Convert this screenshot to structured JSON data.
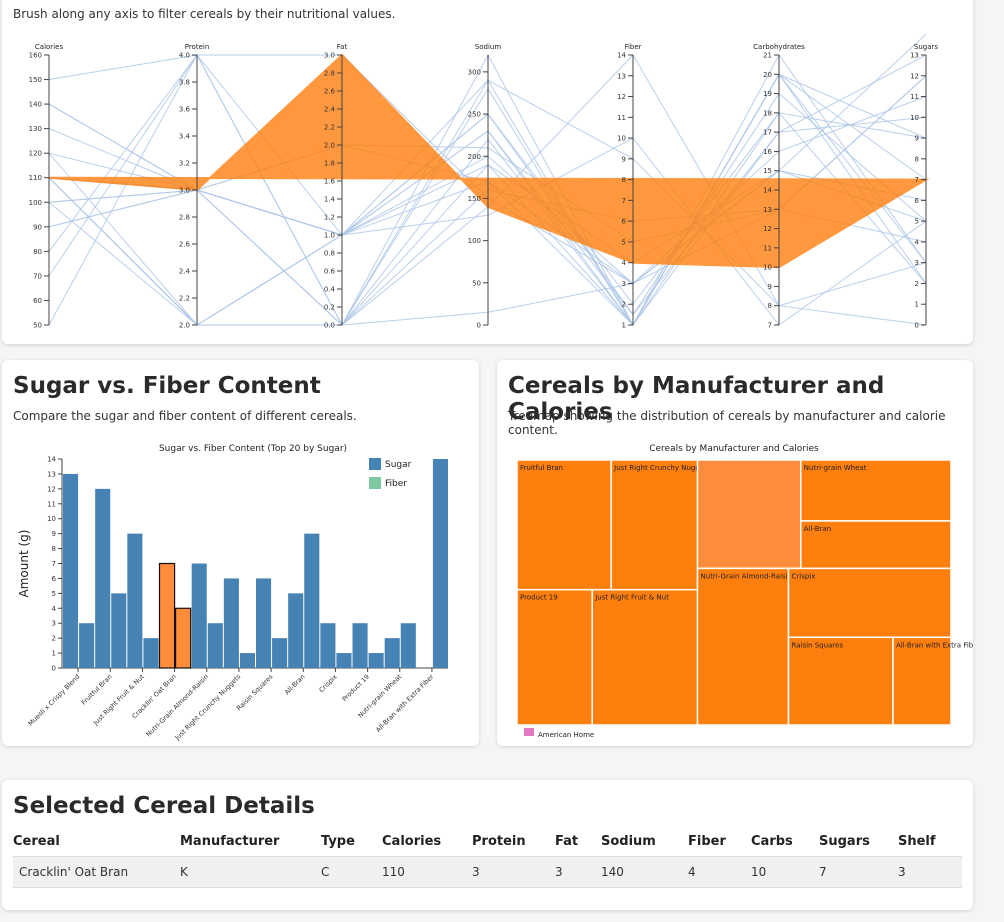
{
  "parallel": {
    "instruction": "Brush along any axis to filter cereals by their nutritional values.",
    "axes": [
      {
        "label": "Calories",
        "min": 50,
        "max": 160,
        "ticks": [
          50,
          60,
          70,
          80,
          90,
          100,
          110,
          120,
          130,
          140,
          150,
          160
        ],
        "dec": 0
      },
      {
        "label": "Protein",
        "min": 2.0,
        "max": 4.0,
        "ticks": [
          2.0,
          2.2,
          2.4,
          2.6,
          2.8,
          3.0,
          3.2,
          3.4,
          3.6,
          3.8,
          4.0
        ],
        "dec": 1
      },
      {
        "label": "Fat",
        "min": 0.0,
        "max": 3.0,
        "ticks": [
          0.0,
          0.2,
          0.4,
          0.6,
          0.8,
          1.0,
          1.2,
          1.4,
          1.6,
          1.8,
          2.0,
          2.2,
          2.4,
          2.6,
          2.8,
          3.0
        ],
        "dec": 1
      },
      {
        "label": "Sodium",
        "min": 0,
        "max": 320,
        "ticks": [
          0,
          50,
          100,
          150,
          200,
          250,
          300
        ],
        "dec": 0
      },
      {
        "label": "Fiber",
        "min": 1,
        "max": 14,
        "ticks": [
          1,
          2,
          3,
          4,
          5,
          6,
          7,
          8,
          9,
          10,
          11,
          12,
          13,
          14
        ],
        "dec": 0
      },
      {
        "label": "Carbohydrates",
        "min": 7,
        "max": 21,
        "ticks": [
          7,
          8,
          9,
          10,
          11,
          12,
          13,
          14,
          15,
          16,
          17,
          18,
          19,
          20,
          21
        ],
        "dec": 0
      },
      {
        "label": "Sugars",
        "min": 0,
        "max": 13,
        "ticks": [
          0,
          1,
          2,
          3,
          4,
          5,
          6,
          7,
          8,
          9,
          10,
          11,
          12,
          13
        ],
        "dec": 0
      }
    ],
    "lines": [
      [
        110,
        2,
        0,
        220,
        1,
        20,
        7
      ],
      [
        110,
        2,
        1,
        290,
        1,
        21,
        3
      ],
      [
        140,
        3,
        1,
        170,
        3,
        13,
        12
      ],
      [
        120,
        3,
        2,
        170,
        1,
        18,
        9
      ],
      [
        100,
        2,
        0,
        190,
        1,
        20,
        9
      ],
      [
        90,
        3,
        0,
        15,
        3,
        15,
        5
      ],
      [
        120,
        2,
        1,
        230,
        1,
        17,
        10
      ],
      [
        110,
        3,
        1,
        250,
        1.5,
        19,
        5
      ],
      [
        100,
        3,
        1,
        200,
        3,
        15,
        6
      ],
      [
        70,
        4,
        1,
        130,
        10,
        7,
        5
      ],
      [
        50,
        4,
        0,
        140,
        14,
        8,
        0
      ],
      [
        80,
        4,
        0,
        290,
        9,
        8,
        3
      ],
      [
        90,
        3,
        0,
        160,
        6,
        13,
        4
      ],
      [
        150,
        4,
        3,
        150,
        3,
        16,
        11
      ],
      [
        110,
        3,
        1,
        230,
        1.5,
        17,
        13
      ],
      [
        130,
        3,
        2,
        210,
        5,
        13,
        12
      ],
      [
        110,
        2,
        0,
        280,
        1,
        20,
        3
      ],
      [
        100,
        3,
        0,
        320,
        1,
        20,
        2
      ],
      [
        110,
        2,
        1,
        250,
        2,
        18,
        2
      ],
      [
        140,
        3,
        1,
        190,
        4,
        15,
        14
      ]
    ],
    "highlight": [
      110,
      3,
      3,
      140,
      4,
      10,
      7
    ]
  },
  "sugar_card": {
    "title": "Sugar vs. Fiber Content",
    "subtitle": "Compare the sugar and fiber content of different cereals."
  },
  "tree_card": {
    "title": "Cereals by Manufacturer and Calories",
    "subtitle": "Treemap showing the distribution of cereals by manufacturer and calorie content."
  },
  "chart_data": [
    {
      "type": "bar",
      "title": "Sugar vs. Fiber Content (Top 20 by Sugar)",
      "ylabel": "Amount (g)",
      "ylim": [
        0,
        14
      ],
      "categories": [
        "Muesli x Crispy Blend",
        "Fruitful Bran",
        "Just Right Fruit & Nut",
        "Cracklin' Oat Bran",
        "Nutri-Grain Almond-Raisin",
        "Just Right Crunchy Nuggets",
        "Raisin Squares",
        "All-Bran",
        "Crispix",
        "Product 19",
        "Nutri-grain Wheat",
        "All-Bran with Extra Fiber"
      ],
      "series": [
        {
          "name": "Sugar",
          "values": [
            13,
            12,
            9,
            7,
            7,
            6,
            6,
            5,
            3,
            3,
            2,
            0
          ]
        },
        {
          "name": "Fiber",
          "values": [
            3,
            5,
            2,
            4,
            3,
            1,
            2,
            9,
            1,
            1,
            3,
            14
          ]
        }
      ],
      "highlight": "Cracklin' Oat Bran",
      "colors": {
        "Sugar": "#4682b4",
        "Fiber": "#7fc7a0",
        "highlight": "#ff8c3a"
      },
      "legend_position": "top-right"
    },
    {
      "type": "treemap",
      "title": "Cereals by Manufacturer and Calories",
      "items": [
        {
          "name": "Fruitful Bran",
          "group": "K",
          "value": 120
        },
        {
          "name": "Just Right Crunchy Nuggets",
          "group": "K",
          "value": 110
        },
        {
          "name": "Product 19",
          "group": "K",
          "value": 100
        },
        {
          "name": "Just Right Fruit & Nut",
          "group": "K",
          "value": 140
        },
        {
          "name": "Cracklin' Oat Bran",
          "group": "K",
          "value": 110
        },
        {
          "name": "Nutri-grain Wheat",
          "group": "K",
          "value": 90
        },
        {
          "name": "All-Bran",
          "group": "K",
          "value": 70
        },
        {
          "name": "Nutri-Grain Almond-Raisin",
          "group": "K",
          "value": 140
        },
        {
          "name": "Crispix",
          "group": "K",
          "value": 110
        },
        {
          "name": "Raisin Squares",
          "group": "K",
          "value": 90
        },
        {
          "name": "All-Bran with Extra Fiber",
          "group": "K",
          "value": 50
        }
      ],
      "legend": [
        {
          "label": "American Home",
          "color": "#e377c2"
        }
      ],
      "colors": {
        "tile": "#ff7f0e",
        "highlight": "#ff8c3a",
        "border": "#ffffff"
      }
    }
  ],
  "details": {
    "title": "Selected Cereal Details",
    "columns": [
      "Cereal",
      "Manufacturer",
      "Type",
      "Calories",
      "Protein",
      "Fat",
      "Sodium",
      "Fiber",
      "Carbs",
      "Sugars",
      "Shelf"
    ],
    "row": [
      "Cracklin' Oat Bran",
      "K",
      "C",
      "110",
      "3",
      "3",
      "140",
      "4",
      "10",
      "7",
      "3"
    ]
  },
  "colors": {
    "line": "#aec7e8",
    "highlight": "#ff7f0e"
  }
}
